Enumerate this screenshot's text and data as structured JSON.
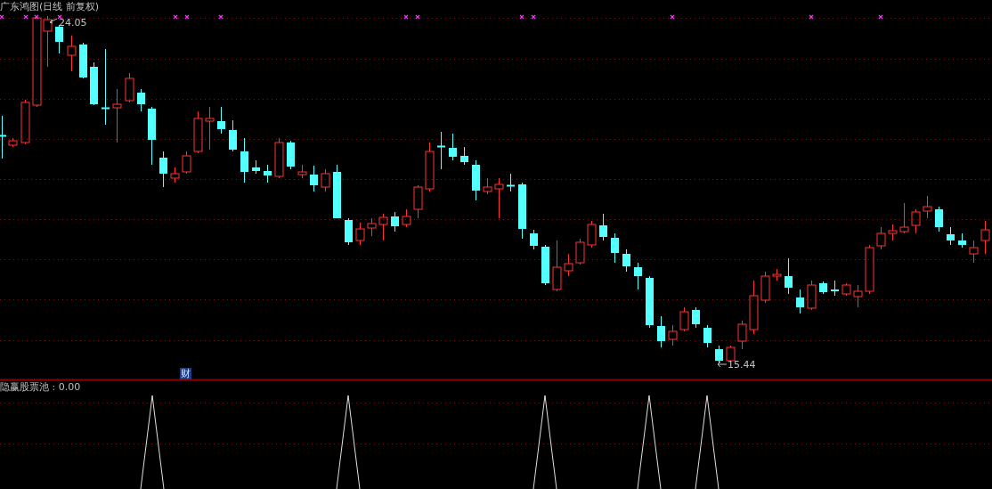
{
  "chart": {
    "title": "广东鸿图(日线 前复权)",
    "high_label": "24.05",
    "low_label": "15.44",
    "event_badge": "财"
  },
  "indicator": {
    "label": "隐赢股票池 : 0.00"
  }
}
